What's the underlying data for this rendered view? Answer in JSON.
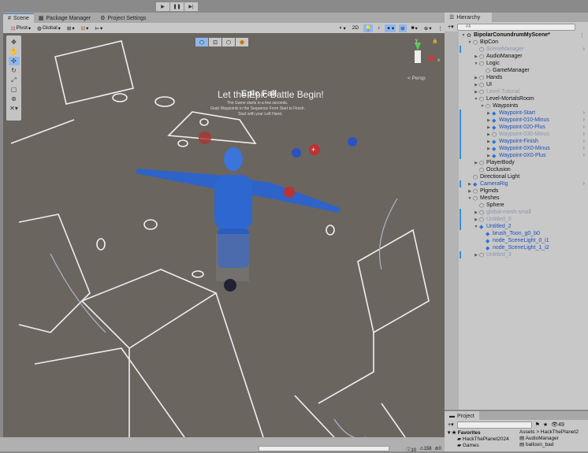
{
  "playbar": {
    "play": "▶",
    "pause": "❚❚",
    "step": "▶|"
  },
  "tabs": [
    {
      "label": "Scene",
      "icon": "hash-icon"
    },
    {
      "label": "Package Manager",
      "icon": "package-icon"
    },
    {
      "label": "Project Settings",
      "icon": "gear-icon"
    }
  ],
  "toolbar": {
    "pivot": "Pivot",
    "global": "Global",
    "mode2d": "2D"
  },
  "scene": {
    "title_a": "Let the Epic Battle Begin!",
    "title_b": "Epic Fail",
    "sub1": "The Game starts in a few seconds.",
    "sub2": "Grab Waypoints in the Sequence From Start to Finish.",
    "sub3": "Start with your Left Hand.",
    "persp": "< Persp",
    "gizmo_y": "y",
    "gizmo_x": "x"
  },
  "hierarchy": {
    "tab": "Hierarchy",
    "search_placeholder": "All",
    "add": "+▾",
    "rows": [
      {
        "label": "BipolarConundrumMyScene*",
        "depth": 0,
        "arrow": "▼",
        "kind": "scene"
      },
      {
        "label": "BipCon",
        "depth": 1,
        "arrow": "▼"
      },
      {
        "label": "SceneManager",
        "depth": 2,
        "arrow": "",
        "kind": "dim",
        "more": true,
        "mark": true
      },
      {
        "label": "AudioManager",
        "depth": 2,
        "arrow": "▶"
      },
      {
        "label": "Logic",
        "depth": 2,
        "arrow": "▼"
      },
      {
        "label": "GameManager",
        "depth": 3,
        "arrow": ""
      },
      {
        "label": "Hands",
        "depth": 2,
        "arrow": "▶"
      },
      {
        "label": "UI",
        "depth": 2,
        "arrow": "▶"
      },
      {
        "label": "Level-Tutorial",
        "depth": 2,
        "arrow": "▶",
        "kind": "grey"
      },
      {
        "label": "Level-MortalsRoom",
        "depth": 2,
        "arrow": "▼"
      },
      {
        "label": "Waypoints",
        "depth": 3,
        "arrow": "▼"
      },
      {
        "label": "Waypoint-Start",
        "depth": 4,
        "arrow": "▶",
        "kind": "prefab",
        "more": true,
        "mark": true
      },
      {
        "label": "Waypoint-010-Minus",
        "depth": 4,
        "arrow": "▶",
        "kind": "prefab",
        "more": true,
        "mark": true
      },
      {
        "label": "Waypoint-020-Plus",
        "depth": 4,
        "arrow": "▶",
        "kind": "prefab",
        "more": true,
        "mark": true
      },
      {
        "label": "Waypoint-030-Minus",
        "depth": 4,
        "arrow": "▶",
        "kind": "dim",
        "more": true,
        "mark": true
      },
      {
        "label": "Waypoint-Finish",
        "depth": 4,
        "arrow": "▶",
        "kind": "prefab",
        "more": true,
        "mark": true
      },
      {
        "label": "Waypoint-0X0-Minus",
        "depth": 4,
        "arrow": "▶",
        "kind": "prefab",
        "more": true,
        "mark": true
      },
      {
        "label": "Waypoint-0X0-Plus",
        "depth": 4,
        "arrow": "▶",
        "kind": "prefab",
        "more": true,
        "mark": true
      },
      {
        "label": "PlayerBody",
        "depth": 2,
        "arrow": "▶"
      },
      {
        "label": "Occlusion",
        "depth": 2,
        "arrow": ""
      },
      {
        "label": "Directional Light",
        "depth": 1,
        "arrow": ""
      },
      {
        "label": "CameraRig",
        "depth": 1,
        "arrow": "▶",
        "kind": "prefab",
        "more": true,
        "mark": true
      },
      {
        "label": "Plgmds",
        "depth": 1,
        "arrow": "▶"
      },
      {
        "label": "Meshes",
        "depth": 1,
        "arrow": "▼"
      },
      {
        "label": "Sphere",
        "depth": 2,
        "arrow": ""
      },
      {
        "label": "global-mesh-small",
        "depth": 2,
        "arrow": "▶",
        "kind": "dim",
        "mark": true
      },
      {
        "label": "Untitled_0",
        "depth": 2,
        "arrow": "▶",
        "kind": "dim",
        "mark": true
      },
      {
        "label": "Untitled_2",
        "depth": 2,
        "arrow": "▼",
        "kind": "prefab",
        "mark": true
      },
      {
        "label": "brush_Toon_g0_b0",
        "depth": 3,
        "arrow": "",
        "kind": "prefab"
      },
      {
        "label": "node_SceneLight_0_i1",
        "depth": 3,
        "arrow": "",
        "kind": "prefab"
      },
      {
        "label": "node_SceneLight_1_i2",
        "depth": 3,
        "arrow": "",
        "kind": "prefab"
      },
      {
        "label": "Untitled_3",
        "depth": 2,
        "arrow": "▶",
        "kind": "dim",
        "mark": true
      }
    ]
  },
  "project": {
    "tab": "Project",
    "count": "49",
    "favorites": "Favorites",
    "fav_items": [
      "HackThePlanet2024",
      "Games"
    ],
    "breadcrumb": "Assets > HackThePlanet2",
    "assets": [
      "AudioManager",
      "balloon_bad"
    ]
  },
  "console": {
    "info": "10",
    "warn": "158",
    "err": "0"
  }
}
